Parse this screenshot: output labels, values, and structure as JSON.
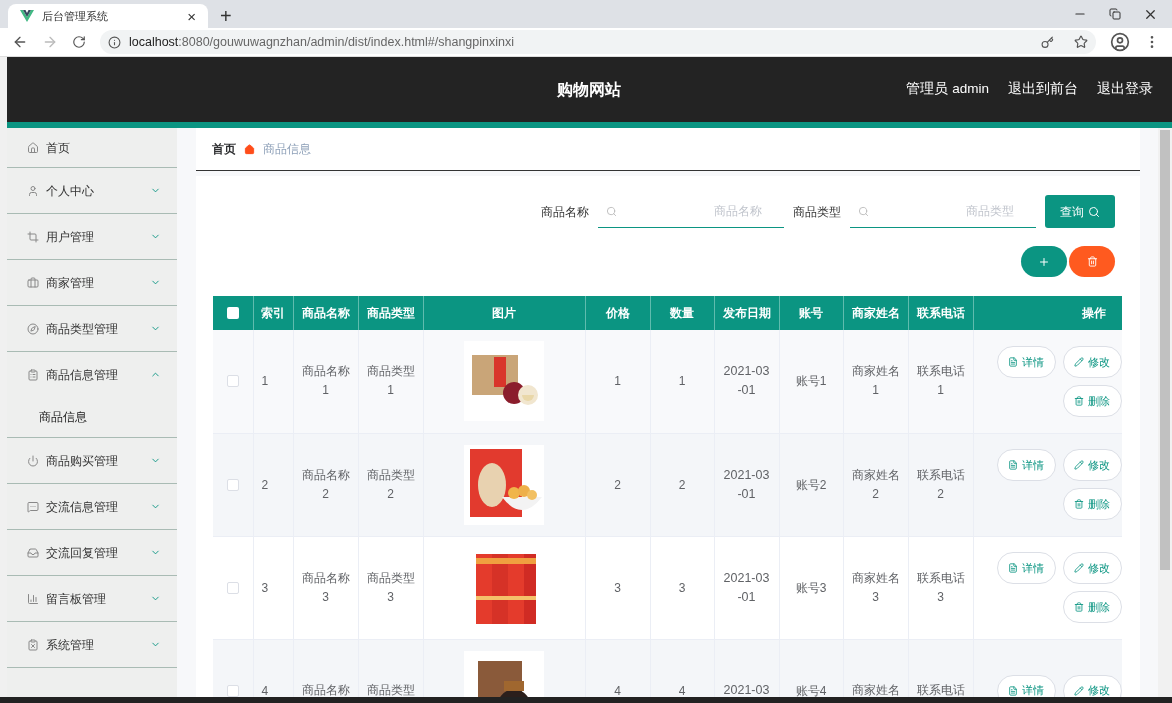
{
  "browser": {
    "tab_title": "后台管理系统",
    "tab_close": "×",
    "new_tab": "+",
    "url_host": "localhost",
    "url_path": ":8080/gouwuwagnzhan/admin/dist/index.html#/shangpinxinxi"
  },
  "header": {
    "title": "购物网站",
    "links": [
      "管理员 admin",
      "退出到前台",
      "退出登录"
    ]
  },
  "sidebar": {
    "items": [
      {
        "label": "首页",
        "kind": "link"
      },
      {
        "label": "个人中心",
        "kind": "menu",
        "expanded": false
      },
      {
        "label": "用户管理",
        "kind": "menu",
        "expanded": false
      },
      {
        "label": "商家管理",
        "kind": "menu",
        "expanded": false
      },
      {
        "label": "商品类型管理",
        "kind": "menu",
        "expanded": false
      },
      {
        "label": "商品信息管理",
        "kind": "menu",
        "expanded": true,
        "children": [
          {
            "label": "商品信息"
          }
        ]
      },
      {
        "label": "商品购买管理",
        "kind": "menu",
        "expanded": false
      },
      {
        "label": "交流信息管理",
        "kind": "menu",
        "expanded": false
      },
      {
        "label": "交流回复管理",
        "kind": "menu",
        "expanded": false
      },
      {
        "label": "留言板管理",
        "kind": "menu",
        "expanded": false
      },
      {
        "label": "系统管理",
        "kind": "menu",
        "expanded": false
      }
    ]
  },
  "breadcrumb": [
    "首页",
    "商品信息"
  ],
  "search": {
    "fields": [
      {
        "label": "商品名称",
        "placeholder": "商品名称"
      },
      {
        "label": "商品类型",
        "placeholder": "商品类型"
      }
    ],
    "button": "查询"
  },
  "table": {
    "columns": [
      "索引",
      "商品名称",
      "商品类型",
      "图片",
      "价格",
      "数量",
      "发布日期",
      "账号",
      "商家姓名",
      "联系电话",
      "操作"
    ],
    "select_all": false,
    "rows": [
      {
        "selected": false,
        "index": "1",
        "name": "商品名称1",
        "type": "商品类型1",
        "picture": {
          "kind": "picture"
        },
        "price": "1",
        "quantity": "1",
        "date": "2021-03-01",
        "account": "账号1",
        "merchant": "商家姓名1",
        "phone": "联系电话1",
        "actions": [
          "详情",
          "修改",
          "删除"
        ]
      },
      {
        "selected": false,
        "index": "2",
        "name": "商品名称2",
        "type": "商品类型2",
        "picture": {
          "kind": "picture"
        },
        "price": "2",
        "quantity": "2",
        "date": "2021-03-01",
        "account": "账号2",
        "merchant": "商家姓名2",
        "phone": "联系电话2",
        "actions": [
          "详情",
          "修改",
          "删除"
        ]
      },
      {
        "selected": false,
        "index": "3",
        "name": "商品名称3",
        "type": "商品类型3",
        "picture": {
          "kind": "picture"
        },
        "price": "3",
        "quantity": "3",
        "date": "2021-03-01",
        "account": "账号3",
        "merchant": "商家姓名3",
        "phone": "联系电话3",
        "actions": [
          "详情",
          "修改",
          "删除"
        ]
      },
      {
        "selected": false,
        "index": "4",
        "name": "商品名称",
        "type": "商品类型",
        "picture": {
          "kind": "picture"
        },
        "price": "4",
        "quantity": "4",
        "date": "2021-03",
        "account": "账号4",
        "merchant": "商家姓名",
        "phone": "联系电话",
        "actions": [
          "详情",
          "修改"
        ]
      }
    ]
  }
}
